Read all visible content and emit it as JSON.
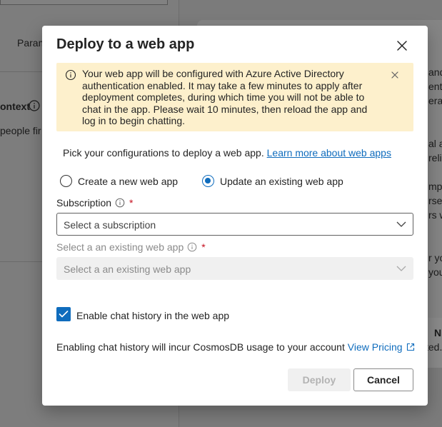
{
  "background": {
    "left_param_text": "Param",
    "left_context_text": "ontext",
    "left_people_text": "people fir",
    "right_fragments": [
      "and",
      "ent, ",
      "erat",
      "al a",
      "relia",
      "mple",
      "rsel",
      "rs w",
      "r yo",
      "you",
      "N",
      "ted."
    ]
  },
  "dialog": {
    "title": "Deploy to a web app",
    "banner": {
      "text": "Your web app will be configured with Azure Active Directory authentication enabled. It may take a few minutes to apply after deployment completes, during which time you will not be able to chat in the app. Please wait 10 minutes, then reload the app and log in to begin chatting."
    },
    "intro": {
      "text": "Pick your configurations to deploy a web app. ",
      "link": "Learn more about web apps"
    },
    "radios": {
      "create_label": "Create a new web app",
      "update_label": "Update an existing web app",
      "selected": "update"
    },
    "subscription": {
      "label": "Subscription",
      "required_mark": "*",
      "value": "Select a subscription"
    },
    "existing_app": {
      "label": "Select a an existing web app",
      "required_mark": "*",
      "value": "Select a an existing web app"
    },
    "chat_history": {
      "label": "Enable chat history in the web app",
      "checked": true
    },
    "note": {
      "text": "Enabling chat history will incur CosmosDB usage to your account ",
      "link": "View Pricing"
    },
    "buttons": {
      "deploy": "Deploy",
      "cancel": "Cancel"
    }
  },
  "colors": {
    "accent": "#0f6cbd",
    "banner_bg": "#fdf0cc",
    "required": "#c50f1f",
    "overlay": "#7b7b7b"
  }
}
